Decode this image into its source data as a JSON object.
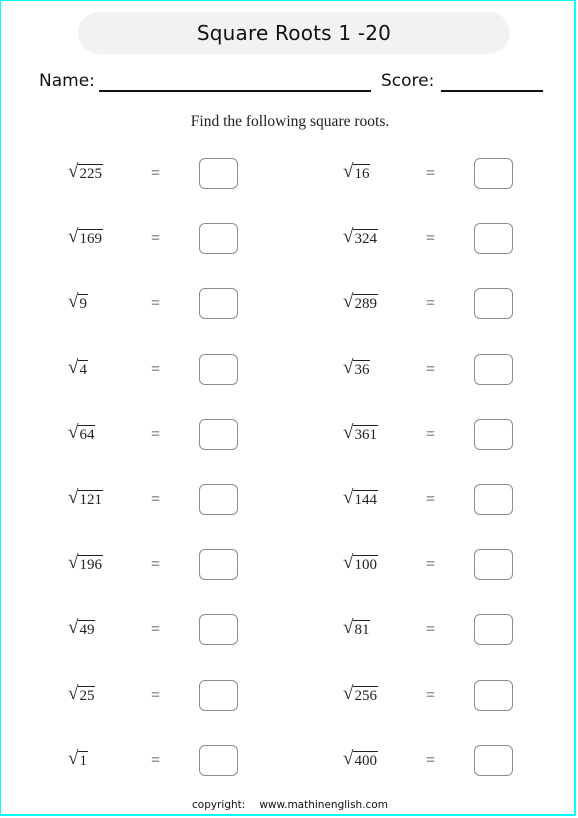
{
  "worksheet": {
    "title": "Square Roots 1 -20",
    "name_label": "Name:",
    "score_label": "Score:",
    "instructions": "Find the following square roots.",
    "equals_sign": "=",
    "radical_symbol": "√",
    "left_column": [
      {
        "radicand": "225"
      },
      {
        "radicand": "169"
      },
      {
        "radicand": "9"
      },
      {
        "radicand": "4"
      },
      {
        "radicand": "64"
      },
      {
        "radicand": "121"
      },
      {
        "radicand": "196"
      },
      {
        "radicand": "49"
      },
      {
        "radicand": "25"
      },
      {
        "radicand": "1"
      }
    ],
    "right_column": [
      {
        "radicand": "16"
      },
      {
        "radicand": "324"
      },
      {
        "radicand": "289"
      },
      {
        "radicand": "36"
      },
      {
        "radicand": "361"
      },
      {
        "radicand": "144"
      },
      {
        "radicand": "100"
      },
      {
        "radicand": "81"
      },
      {
        "radicand": "256"
      },
      {
        "radicand": "400"
      }
    ],
    "footer": {
      "copyright_label": "copyright:",
      "url": "www.mathinenglish.com"
    },
    "colors": {
      "border": "#00ffff",
      "title_background": "#f2f2f2",
      "answer_box_border": "#8c8c8c"
    }
  }
}
